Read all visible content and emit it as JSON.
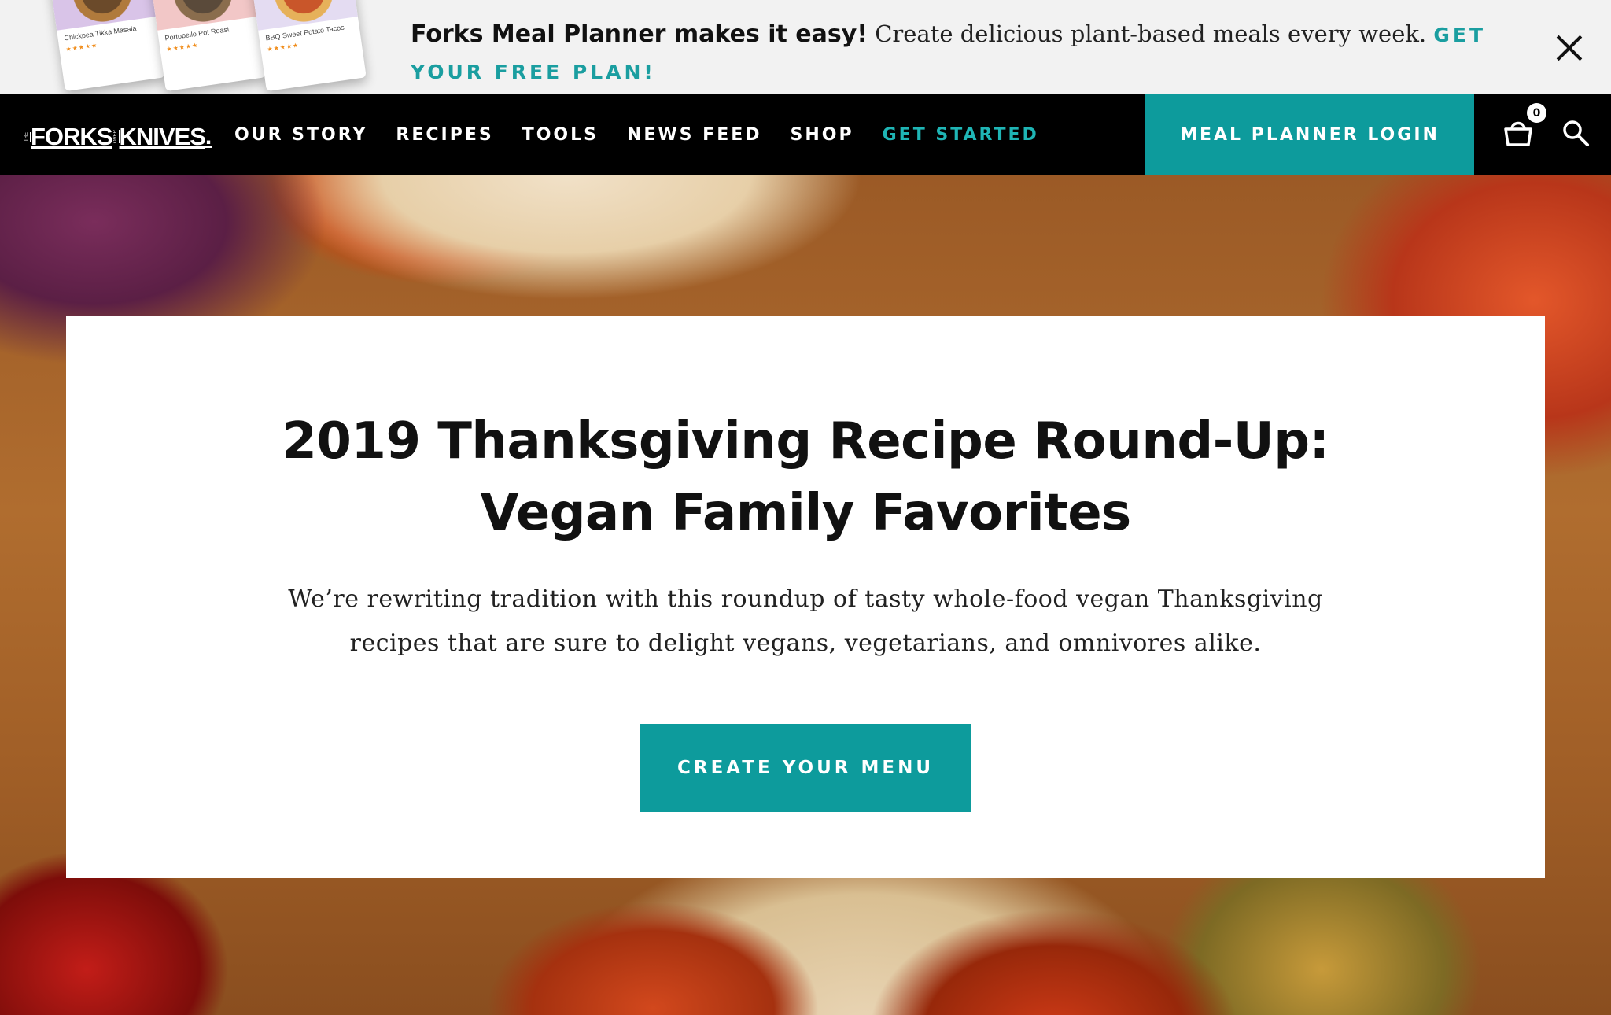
{
  "promo": {
    "bold_text": "Forks Meal Planner makes it easy!",
    "body_text": " Create delicious plant-based meals every week. ",
    "cta": "GET YOUR FREE PLAN!",
    "cards": [
      {
        "title": "Chickpea Tikka Masala",
        "stars": "★★★★★"
      },
      {
        "title": "Portobello Pot Roast",
        "stars": "★★★★★"
      },
      {
        "title": "BBQ Sweet Potato Tacos",
        "stars": "★★★★★"
      }
    ]
  },
  "nav": {
    "logo": {
      "left": "FORKS",
      "small": "OVER",
      "right": "KNIVES",
      "prefix": "THE"
    },
    "links": [
      "OUR STORY",
      "RECIPES",
      "TOOLS",
      "NEWS FEED",
      "SHOP",
      "GET STARTED"
    ],
    "login": "MEAL PLANNER LOGIN",
    "cart_count": "0"
  },
  "hero": {
    "title_line1": "2019 Thanksgiving Recipe Round-Up:",
    "title_line2": "Vegan Family Favorites",
    "subtitle": "We’re rewriting tradition with this roundup of tasty whole-food vegan Thanksgiving recipes that are sure to delight vegans, vegetarians, and omnivores alike.",
    "cta": "CREATE YOUR MENU"
  },
  "colors": {
    "accent": "#0d9b9c",
    "nav_bg": "#000000",
    "promo_bg": "#f2f2f2"
  }
}
